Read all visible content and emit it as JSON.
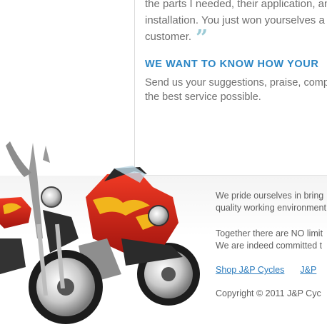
{
  "testimonial": {
    "lines": [
      "the parts I needed, their application, and",
      "installation. You just won yourselves a de",
      "customer."
    ],
    "close_quote": "”"
  },
  "feedback": {
    "heading": "WE WANT TO KNOW HOW YOUR",
    "lines": [
      "Send us your suggestions, praise, compl",
      "the best service possible."
    ]
  },
  "footer": {
    "paragraph1": [
      "We pride ourselves in bring",
      "quality working environment"
    ],
    "paragraph2": [
      "Together there are NO limit",
      "We are indeed committed t"
    ],
    "links": [
      "Shop J&P Cycles",
      "J&P"
    ],
    "copyright": "Copyright © 2011 J&P Cyc"
  },
  "image": {
    "subject": "motorcycles-with-flame-paint",
    "colors": {
      "accent": "#2b86c5",
      "link": "#2a7bbd",
      "flame_red": "#d8281c",
      "flame_yellow": "#f2b51c"
    }
  }
}
